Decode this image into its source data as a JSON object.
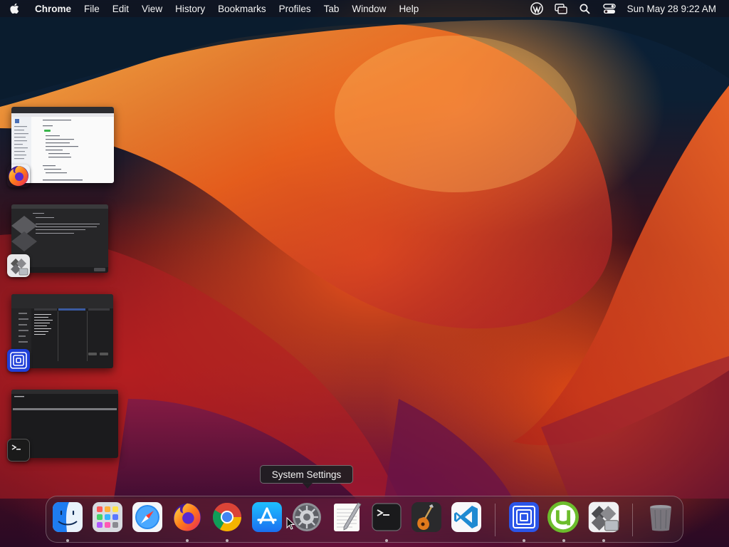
{
  "menubar": {
    "app_name": "Chrome",
    "items": [
      "File",
      "Edit",
      "View",
      "History",
      "Bookmarks",
      "Profiles",
      "Tab",
      "Window",
      "Help"
    ],
    "status_icons": [
      "wordpress-icon",
      "screen-mirror-icon",
      "spotlight-search-icon",
      "control-center-icon"
    ],
    "datetime": "Sun May 28  9:22 AM"
  },
  "stage_manager": {
    "items": [
      {
        "app": "Firefox",
        "icon": "firefox-icon"
      },
      {
        "app": "Boot Camp Assistant",
        "icon": "bootcamp-icon"
      },
      {
        "app": "Lookup app",
        "icon": "blue-square-app-icon"
      },
      {
        "app": "Terminal",
        "icon": "terminal-icon"
      }
    ]
  },
  "tooltip": {
    "text": "System Settings"
  },
  "dock": {
    "apps": [
      {
        "name": "Finder",
        "icon": "finder-icon",
        "running": true
      },
      {
        "name": "Launchpad",
        "icon": "launchpad-icon",
        "running": false
      },
      {
        "name": "Safari",
        "icon": "safari-icon",
        "running": false
      },
      {
        "name": "Firefox",
        "icon": "firefox-icon",
        "running": true
      },
      {
        "name": "Google Chrome",
        "icon": "chrome-icon",
        "running": true
      },
      {
        "name": "App Store",
        "icon": "app-store-icon",
        "running": false
      },
      {
        "name": "System Settings",
        "icon": "system-settings-icon",
        "running": false
      },
      {
        "name": "TextEdit",
        "icon": "textedit-icon",
        "running": false
      },
      {
        "name": "Terminal",
        "icon": "terminal-icon",
        "running": true
      },
      {
        "name": "GarageBand",
        "icon": "garageband-icon",
        "running": false
      },
      {
        "name": "Visual Studio Code",
        "icon": "vscode-icon",
        "running": false
      },
      {
        "name": "Blue Square App",
        "icon": "blue-square-app-icon",
        "running": true
      },
      {
        "name": "uTorrent",
        "icon": "utorrent-icon",
        "running": true
      },
      {
        "name": "Boot Camp Assistant",
        "icon": "bootcamp-icon",
        "running": true
      },
      {
        "name": "Trash",
        "icon": "trash-icon",
        "running": false
      }
    ]
  },
  "colors": {
    "finder_blue": "#1e7cf0",
    "chrome_red": "#db4437",
    "chrome_yellow": "#f4b400",
    "chrome_green": "#0f9d58",
    "vscode_blue": "#1f8ad2",
    "utorrent_green": "#6cbd2c",
    "square_app_blue": "#2b55e8"
  }
}
